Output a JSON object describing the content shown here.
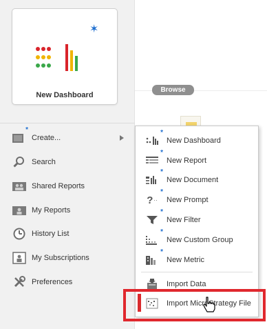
{
  "tile": {
    "label": "New Dashboard"
  },
  "nav": [
    {
      "label": "Create...",
      "icon": "create-icon"
    },
    {
      "label": "Search",
      "icon": "search-icon"
    },
    {
      "label": "Shared Reports",
      "icon": "shared-reports-icon"
    },
    {
      "label": "My Reports",
      "icon": "my-reports-icon"
    },
    {
      "label": "History List",
      "icon": "history-clock-icon"
    },
    {
      "label": "My Subscriptions",
      "icon": "subscriptions-icon"
    },
    {
      "label": "Preferences",
      "icon": "wrench-icon"
    }
  ],
  "browse": {
    "label": "Browse"
  },
  "menu": {
    "items": [
      {
        "label": "New Dashboard",
        "icon": "dashboard-icon"
      },
      {
        "label": "New Report",
        "icon": "report-grid-icon"
      },
      {
        "label": "New Document",
        "icon": "document-icon"
      },
      {
        "label": "New Prompt",
        "icon": "prompt-question-icon"
      },
      {
        "label": "New Filter",
        "icon": "filter-funnel-icon"
      },
      {
        "label": "New Custom Group",
        "icon": "custom-group-icon"
      },
      {
        "label": "New Metric",
        "icon": "metric-icon"
      },
      {
        "label": "Import Data",
        "icon": "import-data-icon"
      },
      {
        "label": "Import MicroStrategy File",
        "icon": "import-file-icon"
      }
    ]
  },
  "colors": {
    "accent_star": "#1f6fd0",
    "highlight": "#e0282e",
    "dot_red": "#d9242b",
    "dot_yellow": "#f0b400",
    "dot_green": "#3aa84a"
  }
}
